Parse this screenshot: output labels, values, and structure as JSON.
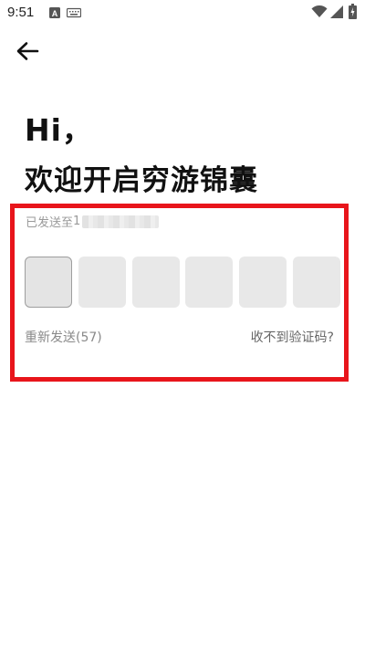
{
  "status_bar": {
    "time": "9:51",
    "icons_left": [
      "a-badge-icon",
      "keyboard-icon"
    ],
    "icons_right": [
      "wifi-icon",
      "signal-icon",
      "battery-icon"
    ]
  },
  "header": {
    "back_icon": "arrow-left-icon"
  },
  "greeting": {
    "line1": "Hi，",
    "line2": "欢迎开启穷游锦囊"
  },
  "verification": {
    "sent_to_label": "已发送至",
    "phone_prefix": "1",
    "code_length": 6,
    "resend_label": "重新发送(57)",
    "no_code_label": "收不到验证码?"
  },
  "colors": {
    "highlight": "#e8151b",
    "box_fill": "#e8e8e8"
  }
}
